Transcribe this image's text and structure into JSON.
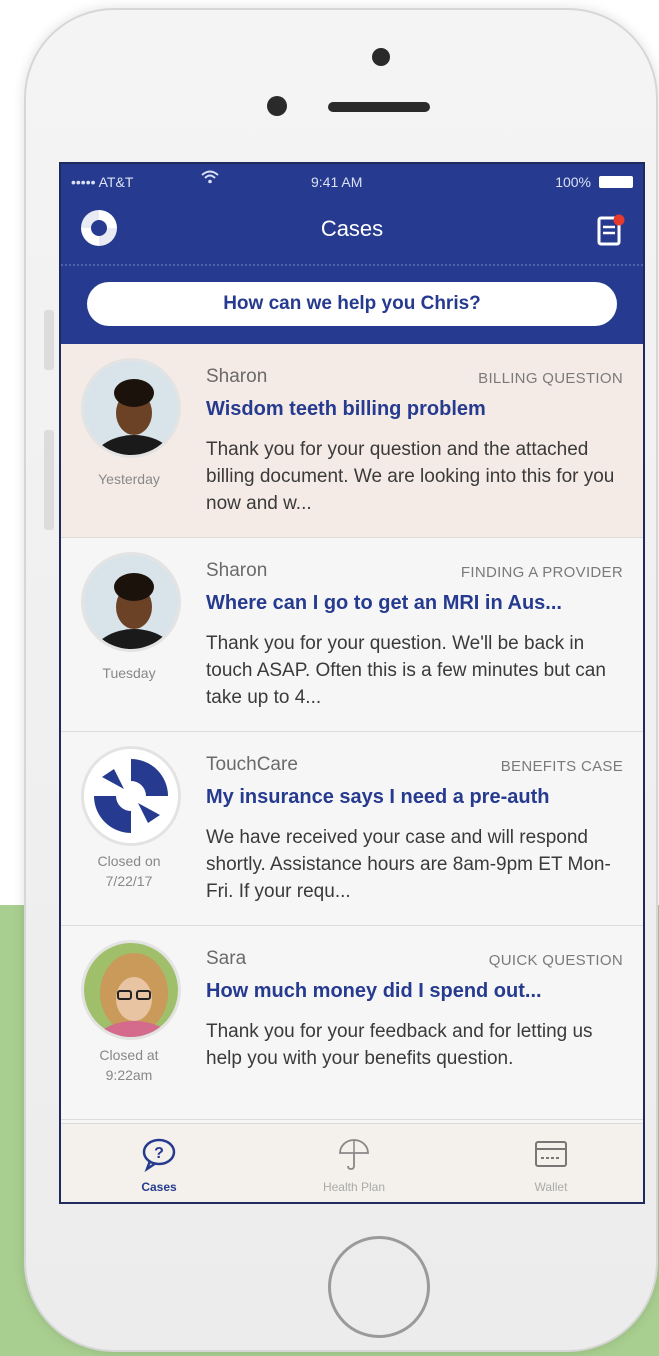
{
  "status_bar": {
    "carrier": "••••• AT&T",
    "time": "9:41 AM",
    "battery": "100%"
  },
  "header": {
    "title": "Cases",
    "help_prompt": "How can we help you Chris?"
  },
  "cases": [
    {
      "sender": "Sharon",
      "category": "BILLING QUESTION",
      "subject": "Wisdom teeth billing problem",
      "preview": "Thank you for your question and the attached billing document. We are looking into this for you now and w...",
      "date_line1": "Yesterday",
      "date_line2": "",
      "highlighted": true
    },
    {
      "sender": "Sharon",
      "category": "FINDING A PROVIDER",
      "subject": "Where can I go to get an MRI in Aus...",
      "preview": "Thank you for your question. We'll be back in touch ASAP. Often this is a few minutes but can take up to 4...",
      "date_line1": "Tuesday",
      "date_line2": "",
      "highlighted": false
    },
    {
      "sender": "TouchCare",
      "category": "BENEFITS CASE",
      "subject": "My insurance says I need a pre-auth",
      "preview": "We have received your case and will respond shortly. Assistance hours are 8am-9pm ET Mon-Fri. If your requ...",
      "date_line1": "Closed on",
      "date_line2": "7/22/17",
      "highlighted": false
    },
    {
      "sender": "Sara",
      "category": "QUICK QUESTION",
      "subject": "How much money did I spend out...",
      "preview": "Thank you for your feedback and for letting us help you with your benefits question.",
      "date_line1": "Closed at",
      "date_line2": "9:22am",
      "highlighted": false
    }
  ],
  "tabs": [
    {
      "label": "Cases",
      "icon": "question-bubble-icon",
      "active": true
    },
    {
      "label": "Health Plan",
      "icon": "umbrella-icon",
      "active": false
    },
    {
      "label": "Wallet",
      "icon": "wallet-card-icon",
      "active": false
    }
  ],
  "colors": {
    "brand": "#263b8f",
    "highlight_row": "#f4ebe6",
    "notification_dot": "#e53b2f",
    "background_accent": "#a9cf90"
  }
}
